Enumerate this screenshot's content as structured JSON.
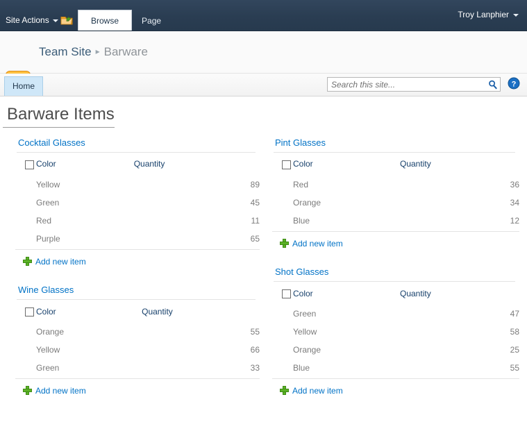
{
  "ribbon": {
    "site_actions_label": "Site Actions",
    "navigate_up_icon": "navigate-up-folder-icon",
    "tabs": [
      {
        "label": "Browse",
        "active": true
      },
      {
        "label": "Page",
        "active": false
      }
    ],
    "user_name": "Troy Lanphier"
  },
  "header": {
    "logo_icon": "team-site-people-logo",
    "breadcrumb": {
      "site": "Team Site",
      "separator": "▸",
      "current": "Barware"
    }
  },
  "nav": {
    "tabs": [
      {
        "label": "Home",
        "selected": true
      }
    ],
    "search": {
      "placeholder": "Search this site...",
      "value": "",
      "go_icon": "search-icon"
    },
    "help_icon": "help-question-icon"
  },
  "page": {
    "title": "Barware Items"
  },
  "colors": {
    "ribbon_navy": "#2c3f55",
    "link_blue": "#0072c6",
    "header_blue": "#17406b",
    "row_gray": "#7b7b7b",
    "plus_green": "#5cb226",
    "logo_orange": "#f7a81c",
    "nav_tab_blue": "#cfe7f8"
  },
  "webparts": [
    {
      "id": "cocktail-glasses",
      "title": "Cocktail Glasses",
      "columns": {
        "name": "Color",
        "quantity": "Quantity"
      },
      "rows": [
        {
          "color": "Yellow",
          "quantity": "89"
        },
        {
          "color": "Green",
          "quantity": "45"
        },
        {
          "color": "Red",
          "quantity": "11"
        },
        {
          "color": "Purple",
          "quantity": "65"
        }
      ],
      "add_new_label": "Add new item"
    },
    {
      "id": "pint-glasses",
      "title": "Pint Glasses",
      "columns": {
        "name": "Color",
        "quantity": "Quantity"
      },
      "rows": [
        {
          "color": "Red",
          "quantity": "36"
        },
        {
          "color": "Orange",
          "quantity": "34"
        },
        {
          "color": "Blue",
          "quantity": "12"
        }
      ],
      "add_new_label": "Add new item"
    },
    {
      "id": "wine-glasses",
      "title": "Wine Glasses",
      "columns": {
        "name": "Color",
        "quantity": "Quantity"
      },
      "rows": [
        {
          "color": "Orange",
          "quantity": "55"
        },
        {
          "color": "Yellow",
          "quantity": "66"
        },
        {
          "color": "Green",
          "quantity": "33"
        }
      ],
      "add_new_label": "Add new item"
    },
    {
      "id": "shot-glasses",
      "title": "Shot Glasses",
      "columns": {
        "name": "Color",
        "quantity": "Quantity"
      },
      "rows": [
        {
          "color": "Green",
          "quantity": "47"
        },
        {
          "color": "Yellow",
          "quantity": "58"
        },
        {
          "color": "Orange",
          "quantity": "25"
        },
        {
          "color": "Blue",
          "quantity": "55"
        }
      ],
      "add_new_label": "Add new item"
    }
  ]
}
